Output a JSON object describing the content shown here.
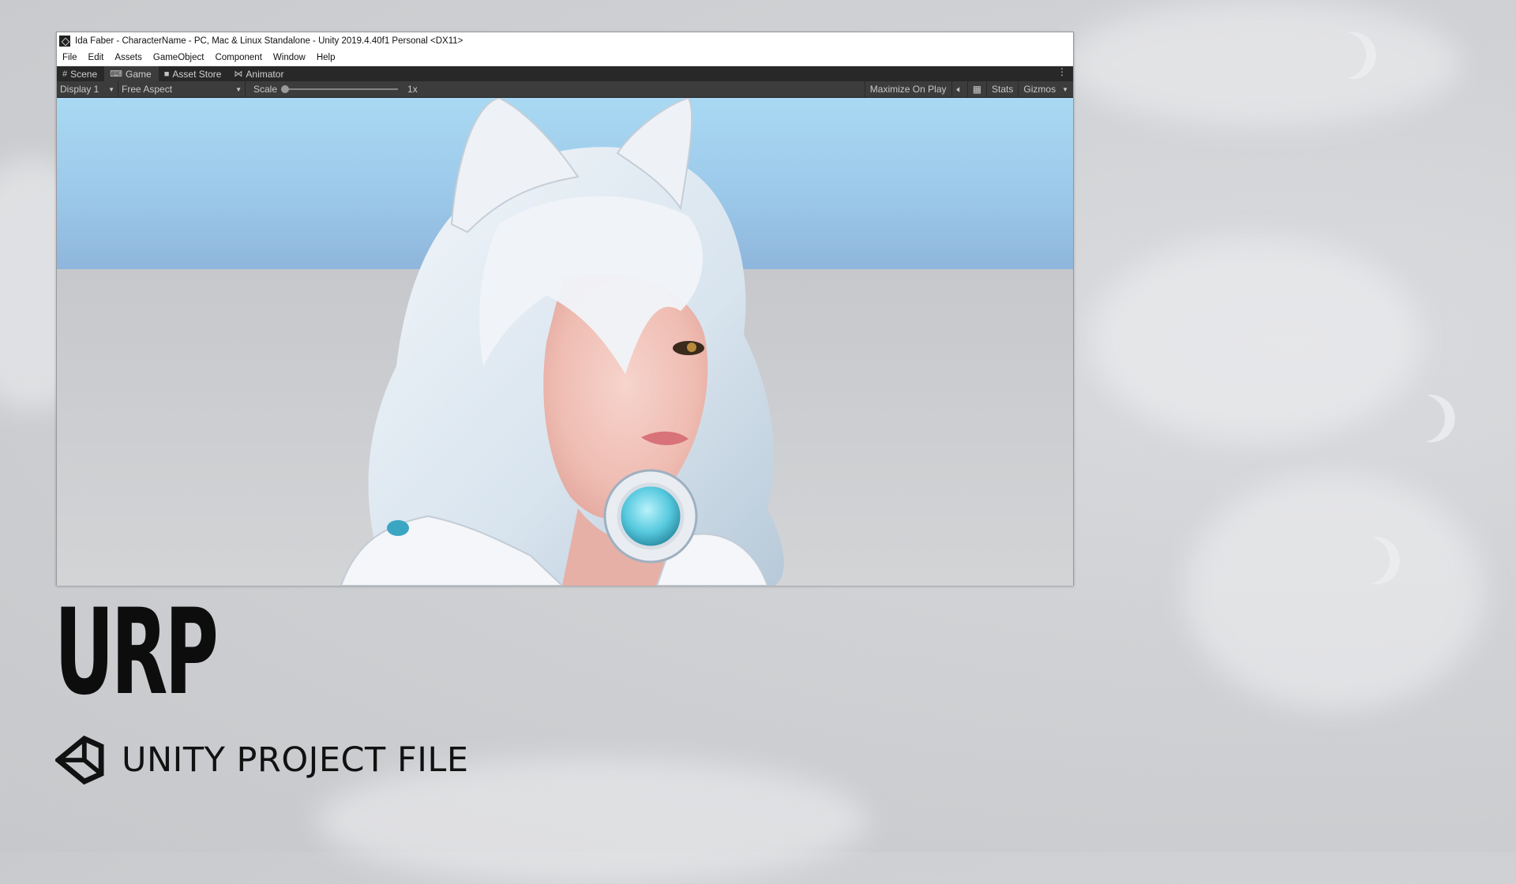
{
  "window": {
    "title": "Ida Faber - CharacterName - PC, Mac & Linux Standalone - Unity 2019.4.40f1 Personal <DX11>"
  },
  "menu": [
    "File",
    "Edit",
    "Assets",
    "GameObject",
    "Component",
    "Window",
    "Help"
  ],
  "tabs": [
    {
      "label": "Scene",
      "icon": "grid-icon"
    },
    {
      "label": "Game",
      "icon": "gamepad-icon"
    },
    {
      "label": "Asset Store",
      "icon": "bag-icon"
    },
    {
      "label": "Animator",
      "icon": "animator-icon"
    }
  ],
  "active_tab": "Game",
  "toolbar": {
    "display": "Display 1",
    "aspect": "Free Aspect",
    "scale_label": "Scale",
    "scale_value": "1x",
    "maximize": "Maximize On Play",
    "stats": "Stats",
    "gizmos": "Gizmos"
  },
  "overlay": {
    "title": "URP",
    "subtitle": "UNITY PROJECT FILE"
  },
  "colors": {
    "background": "#cfd1d4",
    "tab_bar": "#282828",
    "toolbar": "#3c3c3c",
    "sky": "#a9d9f3",
    "text_dark": "#0d0d0d"
  }
}
